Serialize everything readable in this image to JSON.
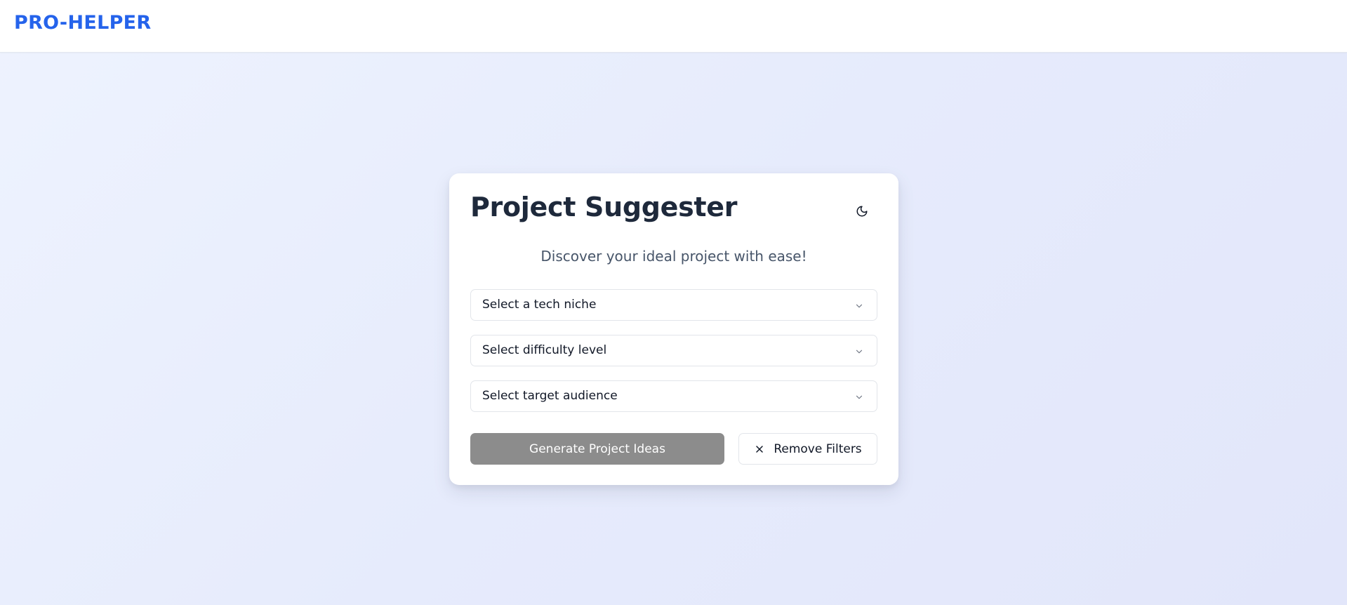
{
  "header": {
    "logo": "PRO-HELPER"
  },
  "card": {
    "title": "Project Suggester",
    "subtitle": "Discover your ideal project with ease!",
    "theme_toggle_icon": "moon-icon"
  },
  "filters": {
    "tech_niche": {
      "placeholder": "Select a tech niche"
    },
    "difficulty": {
      "placeholder": "Select difficulty level"
    },
    "audience": {
      "placeholder": "Select target audience"
    }
  },
  "actions": {
    "generate_label": "Generate Project Ideas",
    "remove_label": "Remove Filters",
    "remove_icon": "close-icon"
  },
  "colors": {
    "brand": "#2563eb",
    "title": "#1e293b",
    "disabled_button": "#8c8c8c"
  }
}
